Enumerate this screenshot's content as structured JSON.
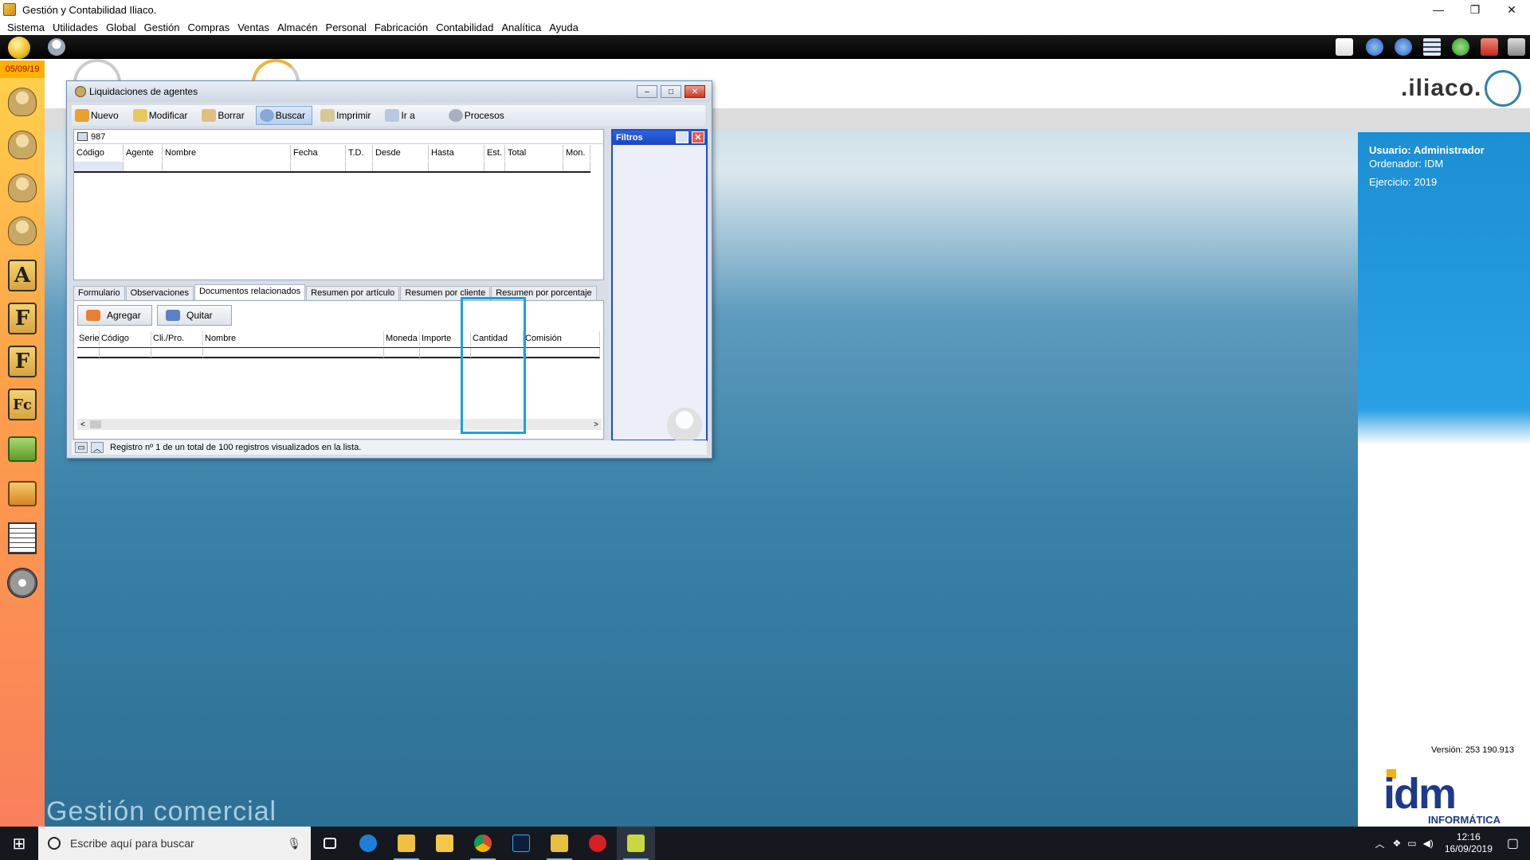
{
  "window": {
    "title": "Gestión y Contabilidad Iliaco.",
    "controls": {
      "minimize": "—",
      "restore": "❐",
      "close": "✕"
    }
  },
  "menu": [
    "Sistema",
    "Utilidades",
    "Global",
    "Gestión",
    "Compras",
    "Ventas",
    "Almacén",
    "Personal",
    "Fabricación",
    "Contabilidad",
    "Analítica",
    "Ayuda"
  ],
  "toolbar_date": "05/09/19",
  "sidebar_icons": [
    {
      "name": "users-icon",
      "kind": "avatar"
    },
    {
      "name": "user-icon",
      "kind": "avatar"
    },
    {
      "name": "user-p-icon",
      "kind": "avatar"
    },
    {
      "name": "user-a-icon",
      "kind": "avatar"
    },
    {
      "name": "letter-a-icon",
      "kind": "letter",
      "letter": "A"
    },
    {
      "name": "letter-f-icon",
      "kind": "letter",
      "letter": "F"
    },
    {
      "name": "letter-f2-icon",
      "kind": "letter",
      "letter": "F"
    },
    {
      "name": "letter-fc-icon",
      "kind": "letter",
      "letter": "Fc"
    },
    {
      "name": "green-bag-icon",
      "kind": "bag"
    },
    {
      "name": "orange-bag-icon",
      "kind": "bag-orange"
    },
    {
      "name": "document-list-icon",
      "kind": "doc"
    },
    {
      "name": "disc-icon",
      "kind": "disc"
    }
  ],
  "logo_text": ".iliaco.",
  "dialog": {
    "title": "Liquidaciones de agentes",
    "toolbar": [
      {
        "label": "Nuevo",
        "color": "#e8a030"
      },
      {
        "label": "Modificar",
        "color": "#e8c860"
      },
      {
        "label": "Borrar",
        "color": "#e0c080"
      },
      {
        "label": "Buscar",
        "color": "#88a8d8",
        "active": true
      },
      {
        "label": "Imprimir",
        "color": "#d8c898"
      },
      {
        "label": "Ir a",
        "color": "#b8c8e0"
      },
      {
        "label": "Procesos",
        "color": "#a8b0c0"
      }
    ],
    "search_value": "987",
    "grid_columns": [
      "Código",
      "Agente",
      "Nombre",
      "Fecha",
      "T.D.",
      "Desde",
      "Hasta",
      "Est.",
      "Total",
      "Mon."
    ],
    "filtros_title": "Filtros",
    "tabs": [
      "Formulario",
      "Observaciones",
      "Documentos relacionados",
      "Resumen por artículo",
      "Resumen por cliente",
      "Resumen por porcentaje"
    ],
    "active_tab": "Documentos relacionados",
    "agregar_label": "Agregar",
    "quitar_label": "Quitar",
    "doc_columns": [
      "Serie",
      "Código",
      "Cli./Pro.",
      "Nombre",
      "Moneda",
      "Importe",
      "Cantidad",
      "Comisión"
    ],
    "status_text": "Registro nº 1 de un total de 100 registros visualizados en la lista."
  },
  "user_panel": {
    "usuario": "Usuario: Administrador",
    "ordenador": "Ordenador: IDM",
    "ejercicio": "Ejercicio: 2019",
    "version": "Versión: 253 190.913"
  },
  "company": {
    "logo": "idm",
    "subtitle": "INFORMÁTICA"
  },
  "desktop_title": "Gestión comercial",
  "taskbar": {
    "search_placeholder": "Escribe aquí para buscar",
    "time": "12:16",
    "date": "16/09/2019"
  },
  "colors": {
    "accent_blue": "#1ca0e0",
    "filtros_blue": "#1f4fd0",
    "date_orange": "#ffb000",
    "panel_blue": "#1d8fd4"
  }
}
